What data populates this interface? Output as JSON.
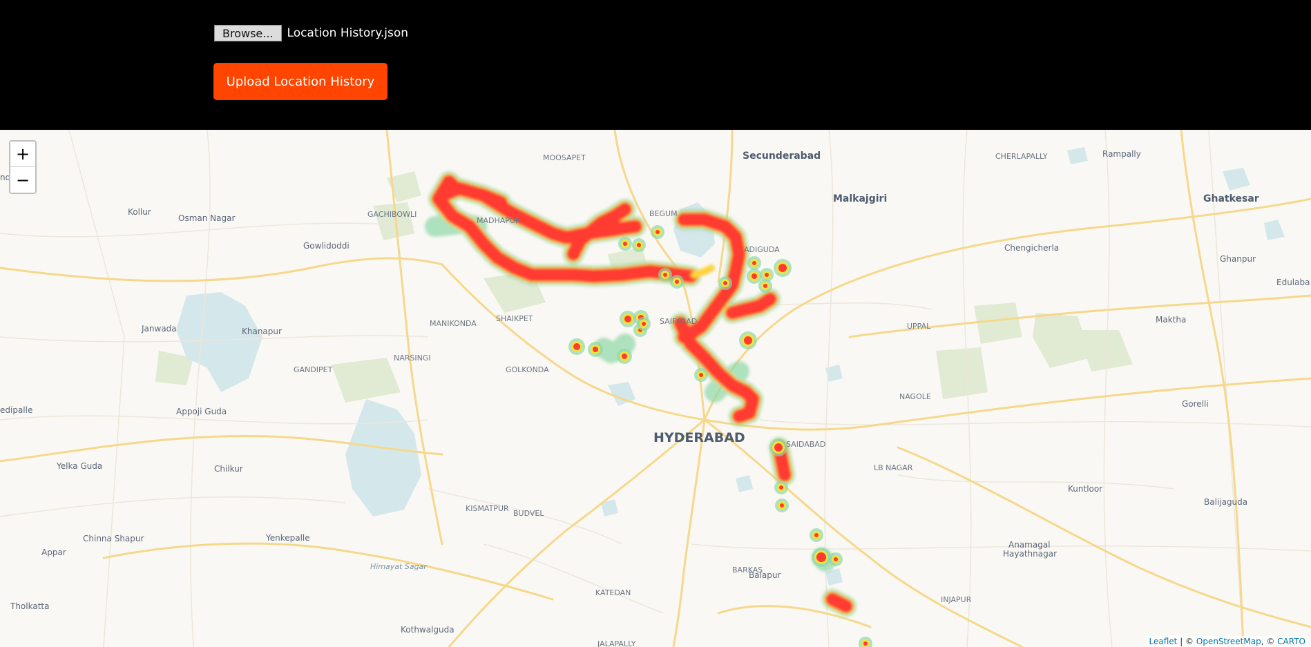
{
  "upload": {
    "browse_label": "Browse...",
    "file_name": "Location History.json",
    "button_label": "Upload Location History"
  },
  "map": {
    "zoom_in": "+",
    "zoom_out": "−",
    "labels": {
      "moosapet": "MOOSAPET",
      "secunderabad": "Secunderabad",
      "cherlapally": "CHERLAPALLY",
      "rampally": "Rampally",
      "kollur": "Kollur",
      "osman_nagar": "Osman Nagar",
      "gachibowli": "GACHIBOWLI",
      "begum": "BEGUM",
      "malkajgiri": "Malkajgiri",
      "ghatkesar": "Ghatkesar",
      "gowlidoddi": "Gowlidoddi",
      "adiguda": "ADIGUDA",
      "chengicherla": "Chengicherla",
      "ghanpur": "Ghanpur",
      "edulaba": "Edulaba",
      "manikonda": "MANIKONDA",
      "shaikpet": "SHAIKPET",
      "saifabad": "SAIFABAD",
      "uppal": "UPPAL",
      "maktha": "Maktha",
      "janwada": "Janwada",
      "khanapur": "Khanapur",
      "narsingi": "NARSINGI",
      "golkonda": "GOLKONDA",
      "gandipet": "GANDIPET",
      "nagole": "NAGOLE",
      "edipalle": "edipalle",
      "appoji_guda": "Appoji Guda",
      "gorelli": "Gorelli",
      "hyderabad": "HYDERABAD",
      "saidabad": "SAIDABAD",
      "yelka_guda": "Yelka Guda",
      "chilkur": "Chilkur",
      "lb_nagar": "LB NAGAR",
      "kismatpur": "KISMATPUR",
      "budvel": "BUDVEL",
      "kuntloor": "Kuntloor",
      "balijaguda": "Balijaguda",
      "chinna_shapur": "Chinna Shapur",
      "yenkepalle": "Yenkepalle",
      "appar": "Appar",
      "himayat_sagar": "Himayat Sagar",
      "barkas": "BARKAS",
      "balapur": "Balapur",
      "anamagal": "Anamagal",
      "hayathnagar": "Hayathnagar",
      "katedan": "KATEDAN",
      "injapur": "INJAPUR",
      "tholkatta": "Tholkatta",
      "kothwalguda": "Kothwalguda",
      "jalapally": "JALAPALLY",
      "nd": "nd",
      "madhapur": "MADHAPUR"
    },
    "attribution": {
      "leaflet": "Leaflet",
      "sep1": " | © ",
      "osm": "OpenStreetMap",
      "sep2": ", © ",
      "carto": "CARTO"
    }
  },
  "colors": {
    "accent": "#ff4500",
    "heat_core": "#ff3b30",
    "heat_mid": "#f5e03a",
    "heat_edge": "#7dd6a0",
    "water": "#d5e8eb",
    "park": "#dfe9cf",
    "major_road": "#fbd88a"
  }
}
